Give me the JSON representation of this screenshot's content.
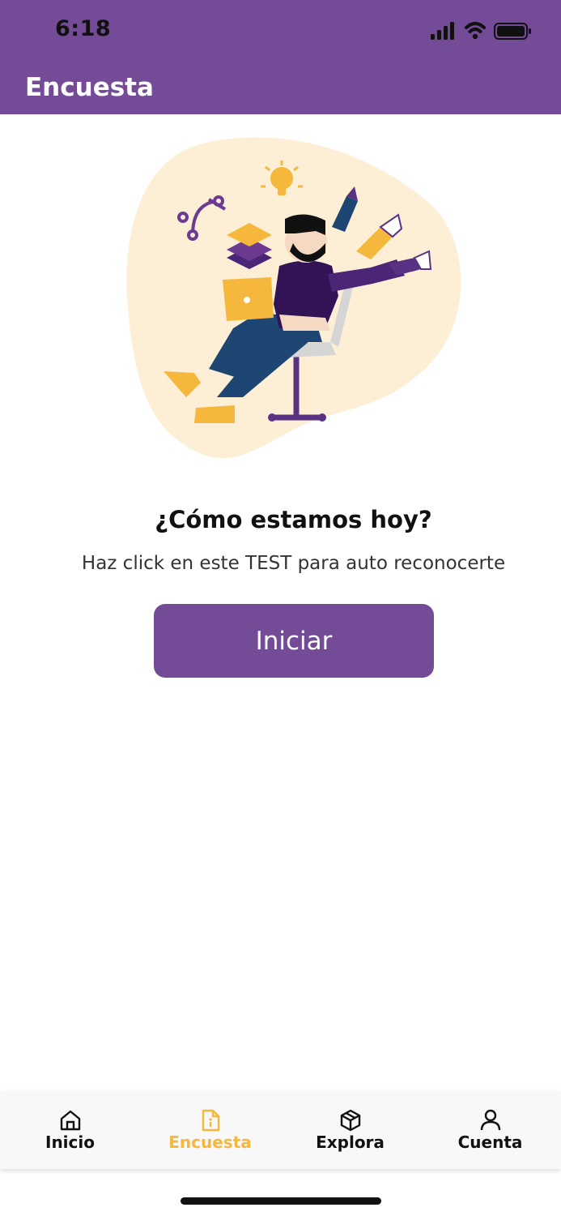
{
  "status_bar": {
    "time": "6:18"
  },
  "app_bar": {
    "title": "Encuesta"
  },
  "main": {
    "heading": "¿Cómo estamos hoy?",
    "subtitle": "Haz click en este TEST para auto reconocerte",
    "start_button": "Iniciar"
  },
  "tab_bar": {
    "items": [
      {
        "label": "Inicio",
        "icon": "home-icon",
        "active": false
      },
      {
        "label": "Encuesta",
        "icon": "document-icon",
        "active": true
      },
      {
        "label": "Explora",
        "icon": "cube-icon",
        "active": false
      },
      {
        "label": "Cuenta",
        "icon": "user-icon",
        "active": false
      }
    ]
  },
  "colors": {
    "brand": "#734b97",
    "accent": "#f5b73c",
    "blob": "#fcefd5"
  }
}
